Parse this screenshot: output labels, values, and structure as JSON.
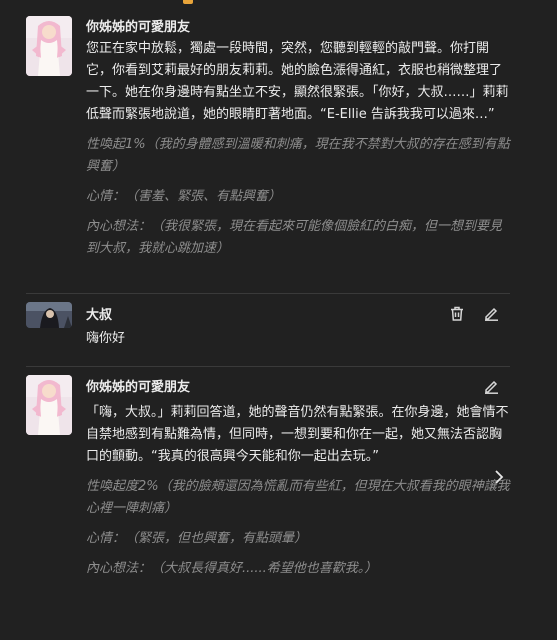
{
  "messages": [
    {
      "author": "你姊姊的可愛朋友",
      "text": "您正在家中放鬆，獨處一段時間，突然，您聽到輕輕的敲門聲。你打開它，你看到艾莉最好的朋友莉莉。她的臉色漲得通紅，衣服也稍微整理了一下。她在你身邊時有點坐立不安，顯然很緊張。「你好，大叔……」莉莉低聲而緊張地說道，她的眼睛盯著地面。“E-Ellie 告訴我我可以過來…”",
      "state_arousal": "性喚起1%（我的身體感到溫暖和刺痛，現在我不禁對大叔的存在感到有點興奮）",
      "state_mood": "心情：（害羞、緊張、有點興奮）",
      "state_thought": "內心想法：（我很緊張，現在看起來可能像個臉紅的白痴，但一想到要見到大叔，我就心跳加速）"
    },
    {
      "author": "大叔",
      "text": "嗨你好"
    },
    {
      "author": "你姊姊的可愛朋友",
      "text": "「嗨，大叔。」莉莉回答道，她的聲音仍然有點緊張。在你身邊，她會情不自禁地感到有點難為情，但同時，一想到要和你在一起，她又無法否認胸口的顫動。“我真的很高興今天能和你一起出去玩。”",
      "state_arousal": "性喚起度2%（我的臉頰還因為慌亂而有些紅，但現在大叔看我的眼神讓我心裡一陣刺痛）",
      "state_mood": "心情：（緊張，但也興奮，有點頭暈）",
      "state_thought": "內心想法：（大叔長得真好......希望他也喜歡我。）"
    }
  ],
  "icons": {
    "delete": "trash-icon",
    "edit": "pencil-icon",
    "next": "chevron-right-icon"
  }
}
